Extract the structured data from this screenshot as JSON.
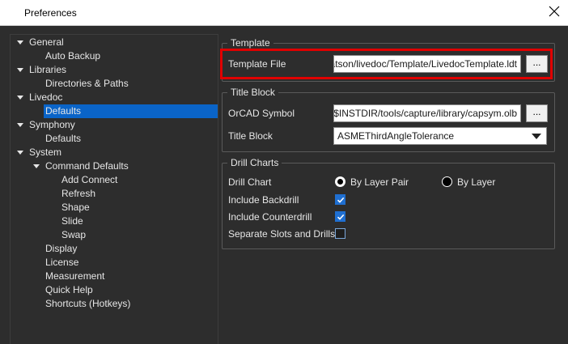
{
  "window": {
    "title": "Preferences",
    "close_icon": "close-icon"
  },
  "tree": {
    "items": [
      {
        "label": "General",
        "expanded": true
      },
      {
        "label": "Auto Backup"
      },
      {
        "label": "Libraries",
        "expanded": true
      },
      {
        "label": "Directories & Paths"
      },
      {
        "label": "Livedoc",
        "expanded": true
      },
      {
        "label": "Defaults",
        "selected": true
      },
      {
        "label": "Symphony",
        "expanded": true
      },
      {
        "label": "Defaults"
      },
      {
        "label": "System",
        "expanded": true
      },
      {
        "label": "Command Defaults",
        "expanded": true
      },
      {
        "label": "Add Connect"
      },
      {
        "label": "Refresh"
      },
      {
        "label": "Shape"
      },
      {
        "label": "Slide"
      },
      {
        "label": "Swap"
      },
      {
        "label": "Display"
      },
      {
        "label": "License"
      },
      {
        "label": "Measurement"
      },
      {
        "label": "Quick Help"
      },
      {
        "label": "Shortcuts (Hotkeys)"
      }
    ]
  },
  "template": {
    "legend": "Template",
    "template_file_label": "Template File",
    "template_file_value": "C:/Users/Jeff.Watson/livedoc/Template/LivedocTemplate.ldt",
    "browse_label": "..."
  },
  "title_block": {
    "legend": "Title Block",
    "orcad_symbol_label": "OrCAD Symbol",
    "orcad_symbol_value": "$INSTDIR/tools/capture/library/capsym.olb",
    "browse_label": "...",
    "title_block_label": "Title Block",
    "title_block_value": "ASMEThirdAngleTolerance"
  },
  "drill_charts": {
    "legend": "Drill Charts",
    "drill_chart_label": "Drill Chart",
    "by_layer_pair_label": "By Layer Pair",
    "by_layer_pair_checked": true,
    "by_layer_label": "By Layer",
    "by_layer_checked": false,
    "include_backdrill_label": "Include Backdrill",
    "include_backdrill_checked": true,
    "include_counterdrill_label": "Include Counterdrill",
    "include_counterdrill_checked": true,
    "separate_slots_label": "Separate Slots and Drills",
    "separate_slots_checked": false
  },
  "colors": {
    "background": "#2d2d2d",
    "selection": "#0a64c8",
    "highlight_border": "#e00000",
    "checkbox_checked": "#1f6fd1"
  }
}
